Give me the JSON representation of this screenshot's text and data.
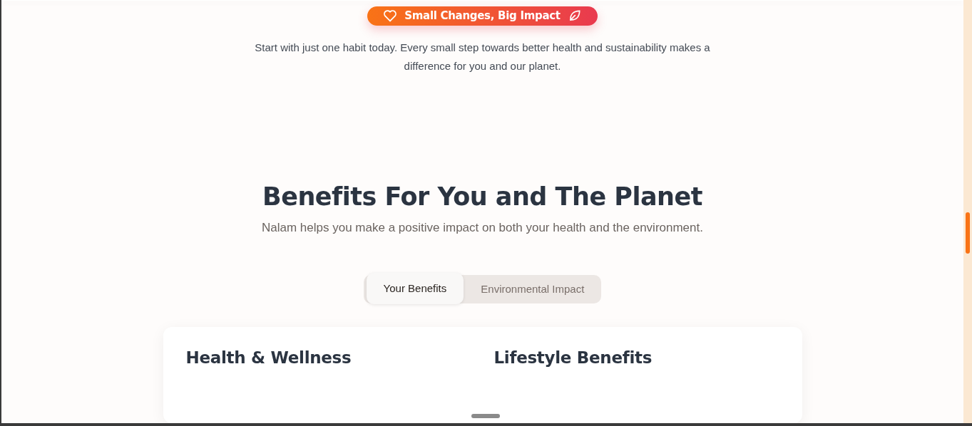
{
  "cta": {
    "label": "Small Changes, Big Impact"
  },
  "intro": "Start with just one habit today. Every small step towards better health and sustainability makes a difference for you and our planet.",
  "benefits": {
    "title": "Benefits For You and The Planet",
    "subtitle": "Nalam helps you make a positive impact on both your health and the environment.",
    "tabs": [
      {
        "label": "Your Benefits",
        "selected": true
      },
      {
        "label": "Environmental Impact",
        "selected": false
      }
    ],
    "columns": [
      {
        "heading": "Health & Wellness"
      },
      {
        "heading": "Lifestyle Benefits"
      }
    ]
  }
}
